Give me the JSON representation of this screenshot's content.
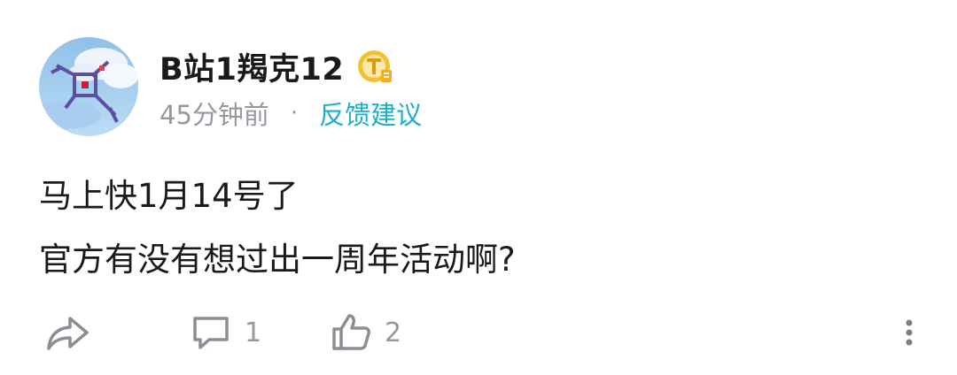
{
  "post": {
    "username": "B站1羯克12",
    "badge_icon": "gold-t-badge-icon",
    "time": "45分钟前",
    "separator": "·",
    "category": "反馈建议",
    "content_lines": [
      "马上快1月14号了",
      "官方有没有想过出一周年活动啊?"
    ]
  },
  "actions": {
    "share_icon": "share-icon",
    "comment_icon": "comment-icon",
    "comment_count": "1",
    "like_icon": "thumbs-up-icon",
    "like_count": "2",
    "more_icon": "more-vertical-icon"
  },
  "colors": {
    "accent": "#1bb0c8",
    "muted": "#9499a0",
    "text": "#1a1a1a",
    "badge_gold": "#f5c030"
  }
}
